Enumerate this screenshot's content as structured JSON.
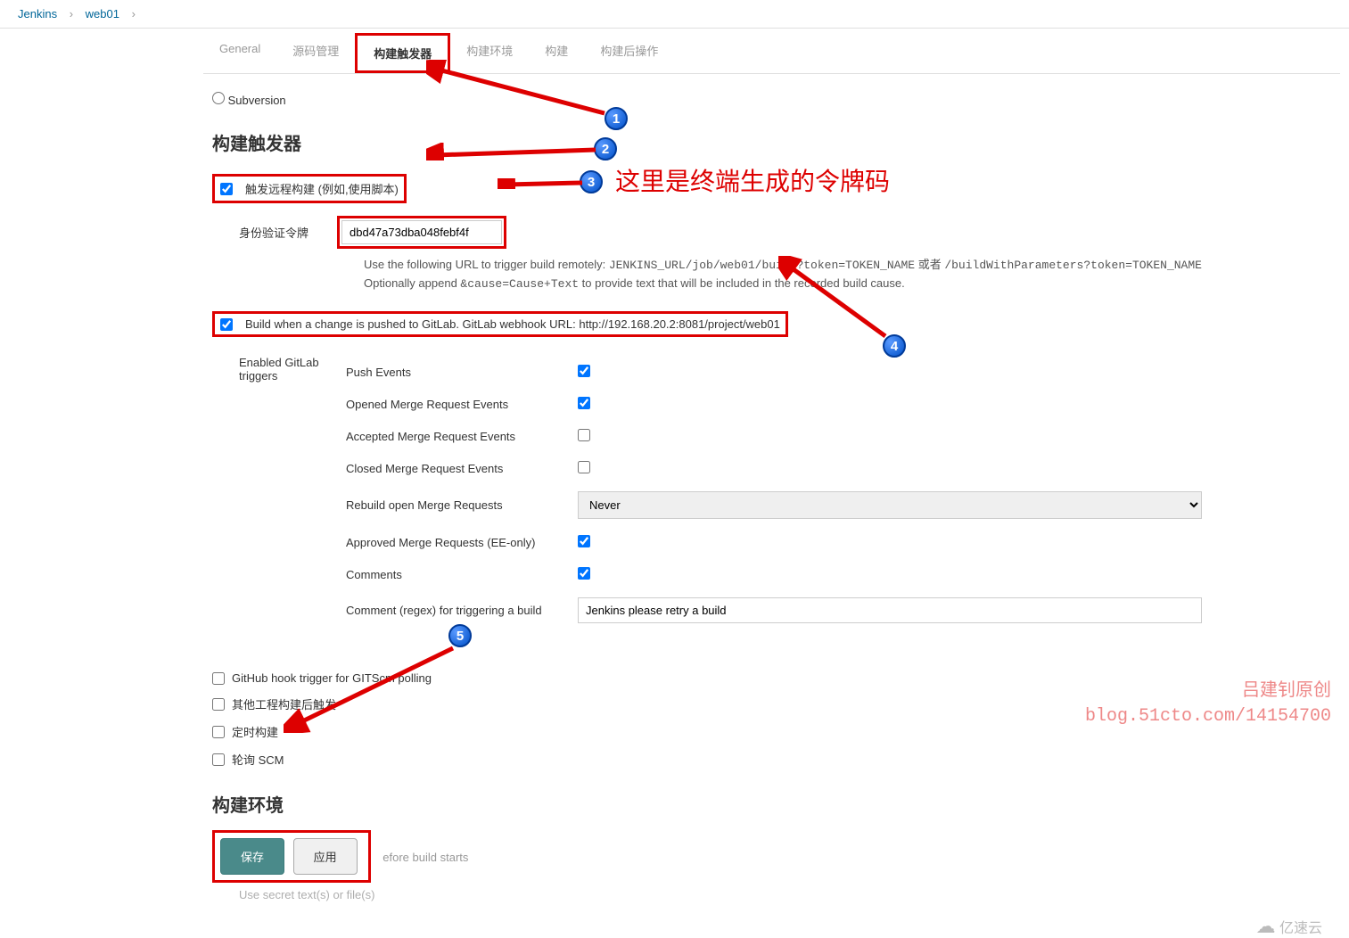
{
  "breadcrumb": {
    "root": "Jenkins",
    "item": "web01"
  },
  "tabs": {
    "general": "General",
    "scm": "源码管理",
    "triggers": "构建触发器",
    "env": "构建环境",
    "build": "构建",
    "post": "构建后操作"
  },
  "subversion": "Subversion",
  "section_triggers_title": "构建触发器",
  "remote_trigger": {
    "label": "触发远程构建 (例如,使用脚本)",
    "token_label": "身份验证令牌",
    "token_value": "dbd47a73dba048febf4f",
    "help1_prefix": "Use the following URL to trigger build remotely: ",
    "help1_url": "JENKINS_URL/job/web01/build?token=TOKEN_NAME",
    "help1_or": " 或者 ",
    "help1_url2": "/buildWithParameters?token=TOKEN_NAME",
    "help2_prefix": "Optionally append ",
    "help2_code": "&cause=Cause+Text",
    "help2_suffix": " to provide text that will be included in the recorded build cause."
  },
  "gitlab": {
    "label": "Build when a change is pushed to GitLab. GitLab webhook URL: http://192.168.20.2:8081/project/web01",
    "triggers_label": "Enabled GitLab triggers",
    "rows": {
      "push": "Push Events",
      "opened_mr": "Opened Merge Request Events",
      "accepted_mr": "Accepted Merge Request Events",
      "closed_mr": "Closed Merge Request Events",
      "rebuild": "Rebuild open Merge Requests",
      "rebuild_value": "Never",
      "approved": "Approved Merge Requests (EE-only)",
      "comments": "Comments",
      "comment_regex": "Comment (regex) for triggering a build",
      "comment_regex_value": "Jenkins please retry a build"
    }
  },
  "bottom": {
    "github_hook": "GitHub hook trigger for GITScm polling",
    "other_proj": "其他工程构建后触发",
    "cron": "定时构建",
    "poll_scm": "轮询 SCM"
  },
  "section_env_title": "构建环境",
  "env_row": {
    "delete_before": "efore build starts",
    "secret_text": "Use secret text(s) or file(s)"
  },
  "buttons": {
    "save": "保存",
    "apply": "应用"
  },
  "annotations": {
    "n1": "1",
    "n2": "2",
    "n3": "3",
    "n4": "4",
    "n5": "5",
    "token_note": "这里是终端生成的令牌码",
    "author1": "吕建钊原创",
    "author2": "blog.51cto.com/14154700",
    "watermark": "亿速云"
  }
}
